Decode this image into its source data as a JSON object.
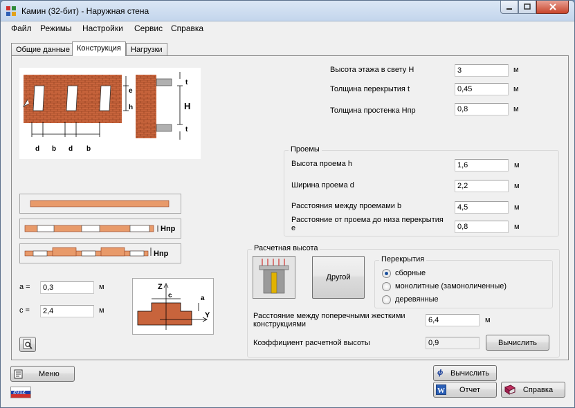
{
  "window": {
    "title": "Камин (32-бит) - Наружная стена"
  },
  "menu": [
    "Файл",
    "Режимы",
    "Настройки",
    "Сервис",
    "Справка"
  ],
  "tabs": [
    "Общие данные",
    "Конструкция",
    "Нагрузки"
  ],
  "active_tab": "Конструкция",
  "fields": {
    "floor_height": {
      "label": "Высота этажа в свету H",
      "value": "3",
      "unit": "м"
    },
    "slab_thickness": {
      "label": "Толщина перекрытия t",
      "value": "0,45",
      "unit": "м"
    },
    "pier_thickness": {
      "label": "Толщина простенка Hпр",
      "value": "0,8",
      "unit": "м"
    }
  },
  "openings": {
    "title": "Проемы",
    "height": {
      "label": "Высота проема h",
      "value": "1,6",
      "unit": "м"
    },
    "width": {
      "label": "Ширина проема d",
      "value": "2,2",
      "unit": "м"
    },
    "spacing": {
      "label": "Расстояния между проемами b",
      "value": "4,5",
      "unit": "м"
    },
    "to_slab": {
      "label_line1": "Расстояние от проема до низа перекрытия",
      "label_line2": "е",
      "value": "0,8",
      "unit": "м"
    }
  },
  "section": {
    "a": {
      "label": "a =",
      "value": "0,3",
      "unit": "м"
    },
    "c": {
      "label": "c =",
      "value": "2,4",
      "unit": "м"
    },
    "hpr_label": "Hпр"
  },
  "figure_labels": {
    "e": "e",
    "h": "h",
    "H": "H",
    "t": "t",
    "d": "d",
    "b": "b",
    "Z": "Z",
    "Y": "Y",
    "c": "c",
    "a": "a"
  },
  "calc_height": {
    "title": "Расчетная высота",
    "other_button": "Другой",
    "slabs_title": "Перекрытия",
    "slab_options": [
      "сборные",
      "монолитные (замоноличенные)",
      "деревянные"
    ],
    "selected_option": 0,
    "stiff_dist": {
      "label_line1": "Расстояние между поперечными жесткими",
      "label_line2": "конструкциями",
      "value": "6,4",
      "unit": "м"
    },
    "coef": {
      "label": "Коэффициент расчетной высоты",
      "value": "0,9"
    },
    "calc_button": "Вычислить"
  },
  "bottom": {
    "menu_button": "Меню",
    "year_badge": "2012",
    "calc_button": "Вычислить",
    "report_button": "Отчет",
    "help_button": "Справка"
  },
  "colors": {
    "brick": "#c8643c",
    "brick_light": "#e89a6a",
    "selection": "#1a4f9c"
  }
}
